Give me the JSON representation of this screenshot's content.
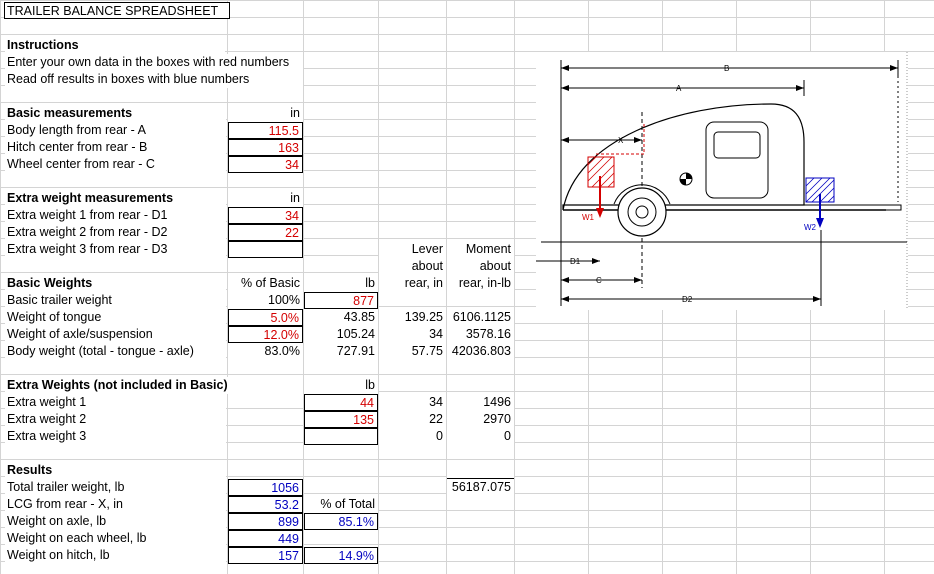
{
  "title": "TRAILER BALANCE SPREADSHEET",
  "instructions": {
    "heading": "Instructions",
    "line1": "Enter your own data in the boxes with red numbers",
    "line2": "Read off results in boxes with blue numbers"
  },
  "basic_measurements": {
    "heading": "Basic measurements",
    "unit": "in",
    "rows": [
      {
        "label": "Body length from rear - A",
        "value": "115.5"
      },
      {
        "label": "Hitch center from rear - B",
        "value": "163"
      },
      {
        "label": "Wheel center from rear - C",
        "value": "34"
      }
    ]
  },
  "extra_measurements": {
    "heading": "Extra weight measurements",
    "unit": "in",
    "rows": [
      {
        "label": "Extra weight 1 from rear - D1",
        "value": "34"
      },
      {
        "label": "Extra weight 2 from rear - D2",
        "value": "22"
      },
      {
        "label": "Extra weight 3 from rear - D3",
        "value": ""
      }
    ]
  },
  "lever_header": {
    "line1": "Lever",
    "line2": "about",
    "line3": "rear, in"
  },
  "moment_header": {
    "line1": "Moment",
    "line2": "about",
    "line3": "rear, in-lb"
  },
  "basic_weights": {
    "heading": "Basic Weights",
    "pct_header": "% of Basic",
    "lb_header": "lb",
    "rows": [
      {
        "label": "Basic trailer weight",
        "pct": "100%",
        "lb": "877",
        "lever": "",
        "moment": ""
      },
      {
        "label": "Weight of tongue",
        "pct": "5.0%",
        "lb": "43.85",
        "lever": "139.25",
        "moment": "6106.1125"
      },
      {
        "label": "Weight of axle/suspension",
        "pct": "12.0%",
        "lb": "105.24",
        "lever": "34",
        "moment": "3578.16"
      },
      {
        "label": "Body weight (total - tongue - axle)",
        "pct": "83.0%",
        "lb": "727.91",
        "lever": "57.75",
        "moment": "42036.803"
      }
    ]
  },
  "extra_weights": {
    "heading": "Extra Weights (not included in Basic)",
    "lb_header": "lb",
    "rows": [
      {
        "label": "Extra weight 1",
        "lb": "44",
        "lever": "34",
        "moment": "1496"
      },
      {
        "label": "Extra weight 2",
        "lb": "135",
        "lever": "22",
        "moment": "2970"
      },
      {
        "label": "Extra weight 3",
        "lb": "",
        "lever": "0",
        "moment": "0"
      }
    ]
  },
  "results": {
    "heading": "Results",
    "total_moment": "56187.075",
    "pct_total_header": "% of Total",
    "rows": [
      {
        "label": "Total trailer weight, lb",
        "value": "1056",
        "pct": ""
      },
      {
        "label": "LCG from rear - X, in",
        "value": "53.2",
        "pct": ""
      },
      {
        "label": "Weight on axle, lb",
        "value": "899",
        "pct": "85.1%"
      },
      {
        "label": "Weight on each wheel, lb",
        "value": "449",
        "pct": ""
      },
      {
        "label": "Weight on hitch, lb",
        "value": "157",
        "pct": "14.9%"
      }
    ]
  },
  "diagram_labels": {
    "a": "A",
    "b": "B",
    "c": "C",
    "x": "X",
    "d1": "D1",
    "d2": "D2",
    "w1": "W1",
    "w2": "W2"
  },
  "colors": {
    "input": "#d40000",
    "output": "#0000c0"
  }
}
